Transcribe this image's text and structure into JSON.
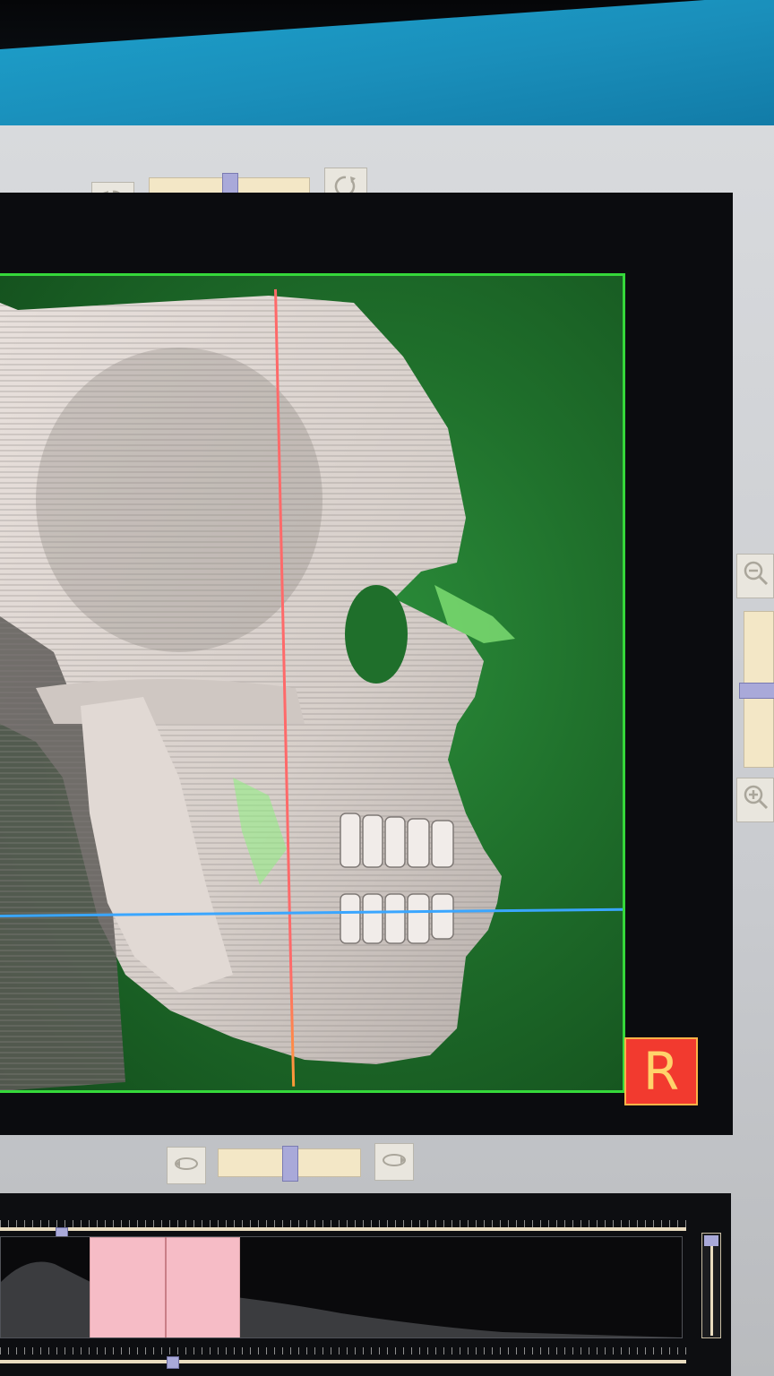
{
  "toolbar_top": {
    "rotate_left_icon": "rotate-ccw-icon",
    "rotate_right_icon": "rotate-cw-icon",
    "rotation_slider_value": 0.5
  },
  "viewport": {
    "orientation_label": "R",
    "border_color": "#35d83a",
    "background_color": "#1f6f2b",
    "crosshair_vertical_color": "#ff6a6a",
    "crosshair_horizontal_color": "#3aa6ff"
  },
  "zoom_panel": {
    "zoom_out_icon": "zoom-out-icon",
    "zoom_in_icon": "zoom-in-icon",
    "zoom_slider_value": 0.5
  },
  "toolbar_bottom": {
    "spin_left_icon": "spin-left-icon",
    "spin_right_icon": "spin-right-icon",
    "spin_slider_value": 0.5
  },
  "histogram": {
    "window_low": 0.13,
    "window_high": 0.35,
    "window_color": "#f6bcc6"
  }
}
